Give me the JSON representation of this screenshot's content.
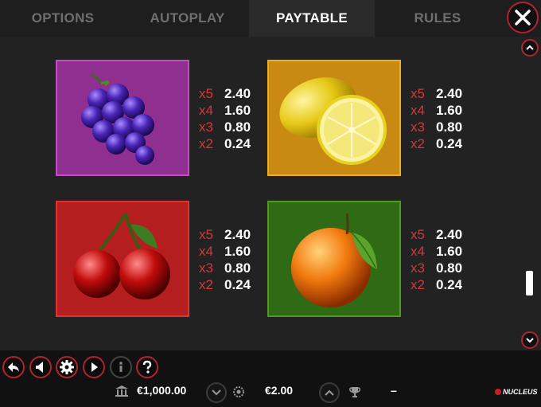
{
  "tabs": [
    {
      "label": "OPTIONS",
      "active": false
    },
    {
      "label": "AUTOPLAY",
      "active": false
    },
    {
      "label": "PAYTABLE",
      "active": true
    },
    {
      "label": "RULES",
      "active": false
    }
  ],
  "symbols": [
    {
      "name": "grapes",
      "box_color": "#8f2f8f",
      "border_color": "#c44bc4",
      "pays": [
        {
          "mult": "x5",
          "amount": "2.40"
        },
        {
          "mult": "x4",
          "amount": "1.60"
        },
        {
          "mult": "x3",
          "amount": "0.80"
        },
        {
          "mult": "x2",
          "amount": "0.24"
        }
      ]
    },
    {
      "name": "lemon",
      "box_color": "#c88a12",
      "border_color": "#eeb020",
      "pays": [
        {
          "mult": "x5",
          "amount": "2.40"
        },
        {
          "mult": "x4",
          "amount": "1.60"
        },
        {
          "mult": "x3",
          "amount": "0.80"
        },
        {
          "mult": "x2",
          "amount": "0.24"
        }
      ]
    },
    {
      "name": "cherries",
      "box_color": "#b51e1e",
      "border_color": "#e23232",
      "pays": [
        {
          "mult": "x5",
          "amount": "2.40"
        },
        {
          "mult": "x4",
          "amount": "1.60"
        },
        {
          "mult": "x3",
          "amount": "0.80"
        },
        {
          "mult": "x2",
          "amount": "0.24"
        }
      ]
    },
    {
      "name": "orange",
      "box_color": "#2f6a14",
      "border_color": "#4f9a22",
      "pays": [
        {
          "mult": "x5",
          "amount": "2.40"
        },
        {
          "mult": "x4",
          "amount": "1.60"
        },
        {
          "mult": "x3",
          "amount": "0.80"
        },
        {
          "mult": "x2",
          "amount": "0.24"
        }
      ]
    }
  ],
  "controls": [
    "back-icon",
    "sound-icon",
    "settings-icon",
    "play-icon",
    "info-icon",
    "help-icon"
  ],
  "status": {
    "balance": "€1,000.00",
    "bet": "€2.00",
    "win": "–"
  },
  "logo_text": "NUCLEUS",
  "colors": {
    "accent": "#b0242d",
    "multiplier": "#d03a3a"
  }
}
